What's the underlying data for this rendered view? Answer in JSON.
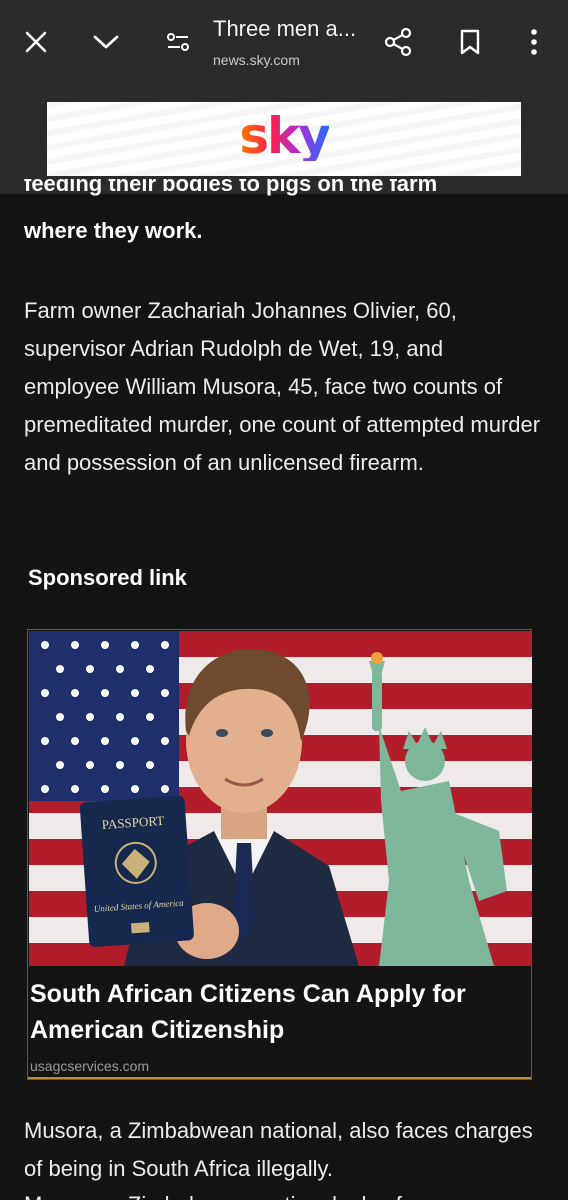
{
  "topbar": {
    "title": "Three men a...",
    "url": "news.sky.com",
    "icons": [
      "close-icon",
      "chevron-down-icon",
      "page-settings-icon",
      "share-icon",
      "bookmark-icon",
      "more-vert-icon"
    ]
  },
  "banner": {
    "logo_text": "sky"
  },
  "article": {
    "cutoff_line": "feeding their bodies to pigs on the farm",
    "lead_end": "where they work.",
    "para1": "Farm owner Zachariah Johannes Olivier, 60, supervisor Adrian Rudolph de Wet, 19, and employee William Musora, 45, face two counts of premeditated murder, one count of attempted murder and possession of an unlicensed firearm.",
    "sponsored_label": "Sponsored link",
    "para2": "Musora, a Zimbabwean national, also faces charges of being in South Africa illegally.",
    "para3_cut": "Musora, a Zimbabwean national, also faces"
  },
  "ad": {
    "headline": "South African Citizens Can Apply for American Citizenship",
    "domain": "usagcservices.com",
    "passport_title": "PASSPORT",
    "passport_sub": "United States of America"
  },
  "colors": {
    "background": "#141414",
    "topbar": "#2b2b2d",
    "ad_border": "#6b5a3a"
  }
}
